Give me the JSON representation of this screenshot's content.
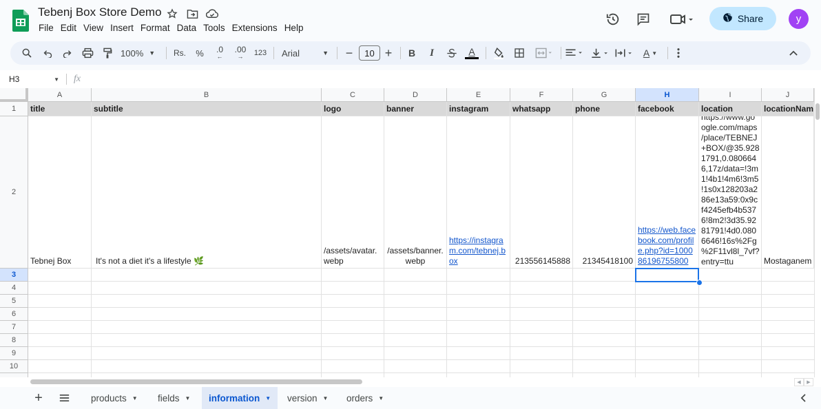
{
  "app": {
    "title": "Tebenj Box Store Demo",
    "menu": [
      "File",
      "Edit",
      "View",
      "Insert",
      "Format",
      "Data",
      "Tools",
      "Extensions",
      "Help"
    ],
    "share_label": "Share",
    "avatar_initial": "y"
  },
  "toolbar": {
    "zoom": "100%",
    "currency": "Rs.",
    "percent": "%",
    "dec_decrease": ".0",
    "dec_increase": ".00",
    "format_123": "123",
    "font": "Arial",
    "font_size": "10",
    "bold": "B",
    "italic": "I",
    "text_color": "A",
    "text_rotate": "A"
  },
  "formula_bar": {
    "cell_ref": "H3",
    "fx": "fx",
    "value": ""
  },
  "columns": [
    "A",
    "B",
    "C",
    "D",
    "E",
    "F",
    "G",
    "H",
    "I",
    "J"
  ],
  "selected_column": "H",
  "rows": [
    "1",
    "2",
    "3",
    "4",
    "5",
    "6",
    "7",
    "8",
    "9",
    "10"
  ],
  "selected_row": "3",
  "header_row": [
    "title",
    "subtitle",
    "logo",
    "banner",
    "instagram",
    "whatsapp",
    "phone",
    "facebook",
    "location",
    "locationNam"
  ],
  "data_row": {
    "title": "Tebnej Box",
    "subtitle": "It's not a diet it's a lifestyle 🌿",
    "logo": "/assets/avatar.\nwebp",
    "banner": "/assets/banner.\nwebp",
    "instagram": "https://instagra\nm.com/tebnej.b\nox",
    "whatsapp": "213556145888",
    "phone": "21345418100",
    "facebook": "https://web.face\nbook.com/profil\ne.php?id=1000\n86196755800",
    "location": "https://www.go\nogle.com/maps\n/place/TEBNEJ\n+BOX/@35.928\n1791,0.080664\n6,17z/data=!3m\n1!4b1!4m6!3m5\n!1s0x128203a2\n86e13a59:0x9c\nf4245efb4b537\n6!8m2!3d35.92\n81791!4d0.080\n6646!16s%2Fg\n%2F11vl8l_7vf?\nentry=ttu",
    "locationName": "Mostaganem"
  },
  "sheets": [
    {
      "name": "products",
      "active": false
    },
    {
      "name": "fields",
      "active": false
    },
    {
      "name": "information",
      "active": true
    },
    {
      "name": "version",
      "active": false
    },
    {
      "name": "orders",
      "active": false
    }
  ],
  "colors": {
    "accent": "#0b57d0",
    "share_bg": "#c2e7ff",
    "avatar_bg": "#a142f4",
    "header_row_bg": "#d9d9d9",
    "link": "#1155cc"
  }
}
